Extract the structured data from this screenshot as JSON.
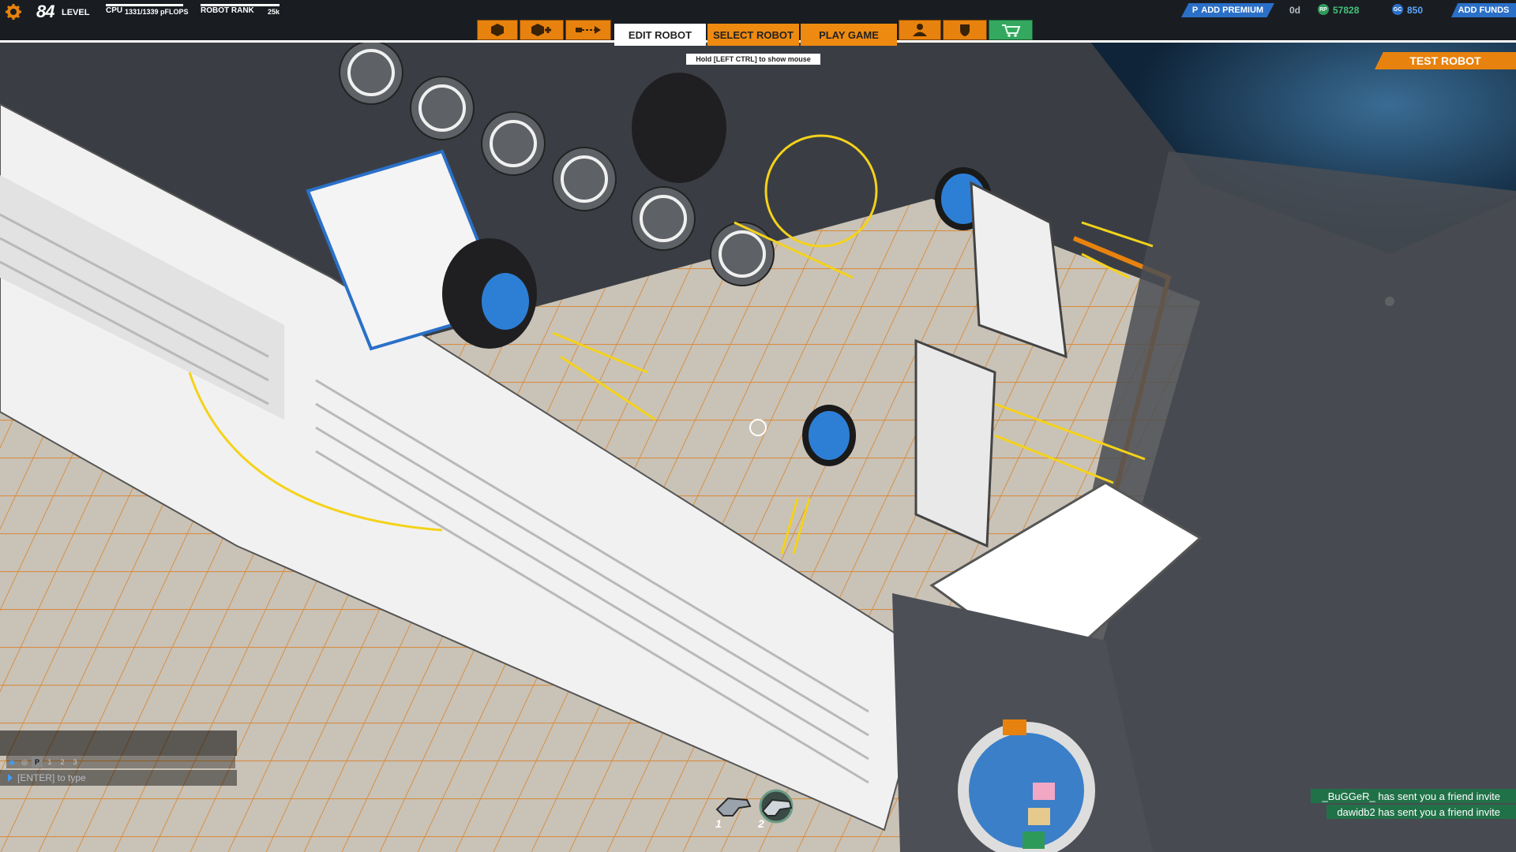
{
  "hud": {
    "level_number": "84",
    "level_label": "LEVEL",
    "cpu_label": "CPU",
    "cpu_value": "1331/1339 pFLOPS",
    "rank_label": "ROBOT RANK",
    "rank_value": "25k"
  },
  "tabs": {
    "icon_tab_1": "cube-icon",
    "icon_tab_2": "cube-plus-icon",
    "icon_tab_3": "connector-icon",
    "edit_robot": "EDIT ROBOT",
    "select_robot": "SELECT ROBOT",
    "play_game": "PLAY GAME",
    "icon_tab_4": "player-icon",
    "icon_tab_5": "shield-icon",
    "icon_tab_6": "shop-icon"
  },
  "hint": "Hold [LEFT CTRL] to show mouse",
  "account": {
    "premium_label": "ADD PREMIUM",
    "premium_days": "0d",
    "robits": "57828",
    "galaxy_coins": "850",
    "add_funds_label": "ADD FUNDS"
  },
  "test_robot_label": "TEST ROBOT",
  "chat": {
    "tabs": [
      "1",
      "2",
      "3"
    ],
    "input_placeholder": "[ENTER] to type"
  },
  "notifications": [
    "_BuGGeR_ has sent you a friend invite",
    "dawidb2 has sent you a friend invite"
  ],
  "weapon_slots": [
    {
      "number": "1",
      "icon": "gun-icon"
    },
    {
      "number": "2",
      "icon": "gun-icon"
    }
  ],
  "colors": {
    "accent_orange": "#e8820e",
    "premium_blue": "#2a6fc8",
    "robits_green": "#45c27a",
    "notification_green": "#1b7846"
  }
}
